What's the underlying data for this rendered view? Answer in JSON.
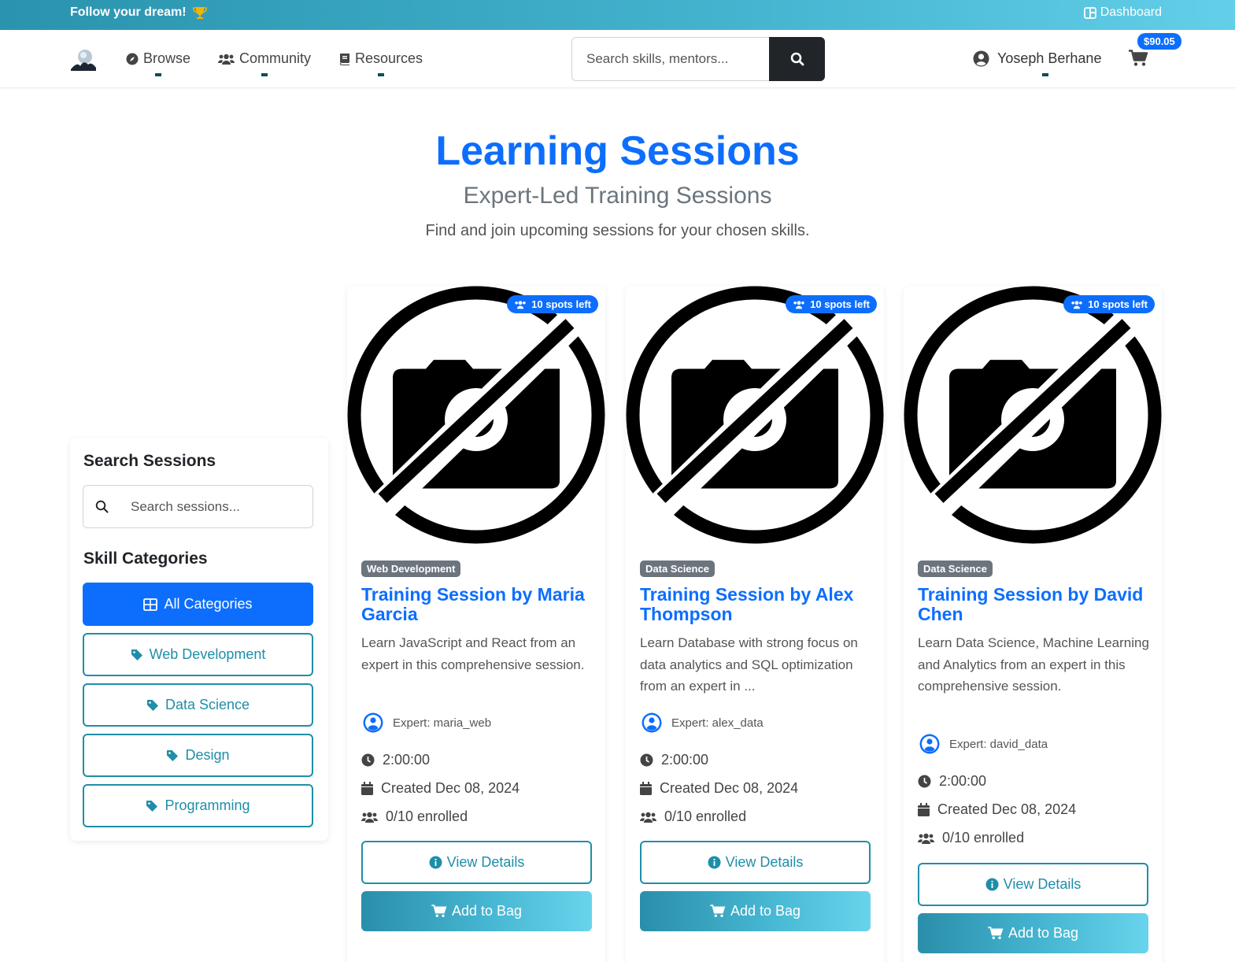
{
  "topbar": {
    "dream": "Follow your dream!",
    "dashboard": "Dashboard"
  },
  "nav": {
    "links": [
      "Browse",
      "Community",
      "Resources"
    ],
    "search_placeholder": "Search skills, mentors...",
    "user": "Yoseph Berhane",
    "cart_total": "$90.05"
  },
  "hero": {
    "title": "Learning Sessions",
    "subtitle": "Expert-Led Training Sessions",
    "description": "Find and join upcoming sessions for your chosen skills."
  },
  "sidebar": {
    "search_title": "Search Sessions",
    "search_placeholder": "Search sessions...",
    "categories_title": "Skill Categories",
    "categories": [
      "All Categories",
      "Web Development",
      "Data Science",
      "Design",
      "Programming"
    ]
  },
  "cards": [
    {
      "spots": "10 spots left",
      "category": "Web Development",
      "title": "Training Session by Maria Garcia",
      "description": "Learn JavaScript and React from an expert in this comprehensive session.",
      "expert": "Expert: maria_web",
      "duration": "2:00:00",
      "created": "Created Dec 08, 2024",
      "enrolled": "0/10 enrolled",
      "view_label": "View Details",
      "add_label": "Add to Bag"
    },
    {
      "spots": "10 spots left",
      "category": "Data Science",
      "title": "Training Session by Alex Thompson",
      "description": "Learn Database with strong focus on data analytics and SQL optimization from an expert in ...",
      "expert": "Expert: alex_data",
      "duration": "2:00:00",
      "created": "Created Dec 08, 2024",
      "enrolled": "0/10 enrolled",
      "view_label": "View Details",
      "add_label": "Add to Bag"
    },
    {
      "spots": "10 spots left",
      "category": "Data Science",
      "title": "Training Session by David Chen",
      "description": "Learn Data Science, Machine Learning and Analytics from an expert in this comprehensive session.",
      "expert": "Expert: david_data",
      "duration": "2:00:00",
      "created": "Created Dec 08, 2024",
      "enrolled": "0/10 enrolled",
      "view_label": "View Details",
      "add_label": "Add to Bag"
    }
  ]
}
